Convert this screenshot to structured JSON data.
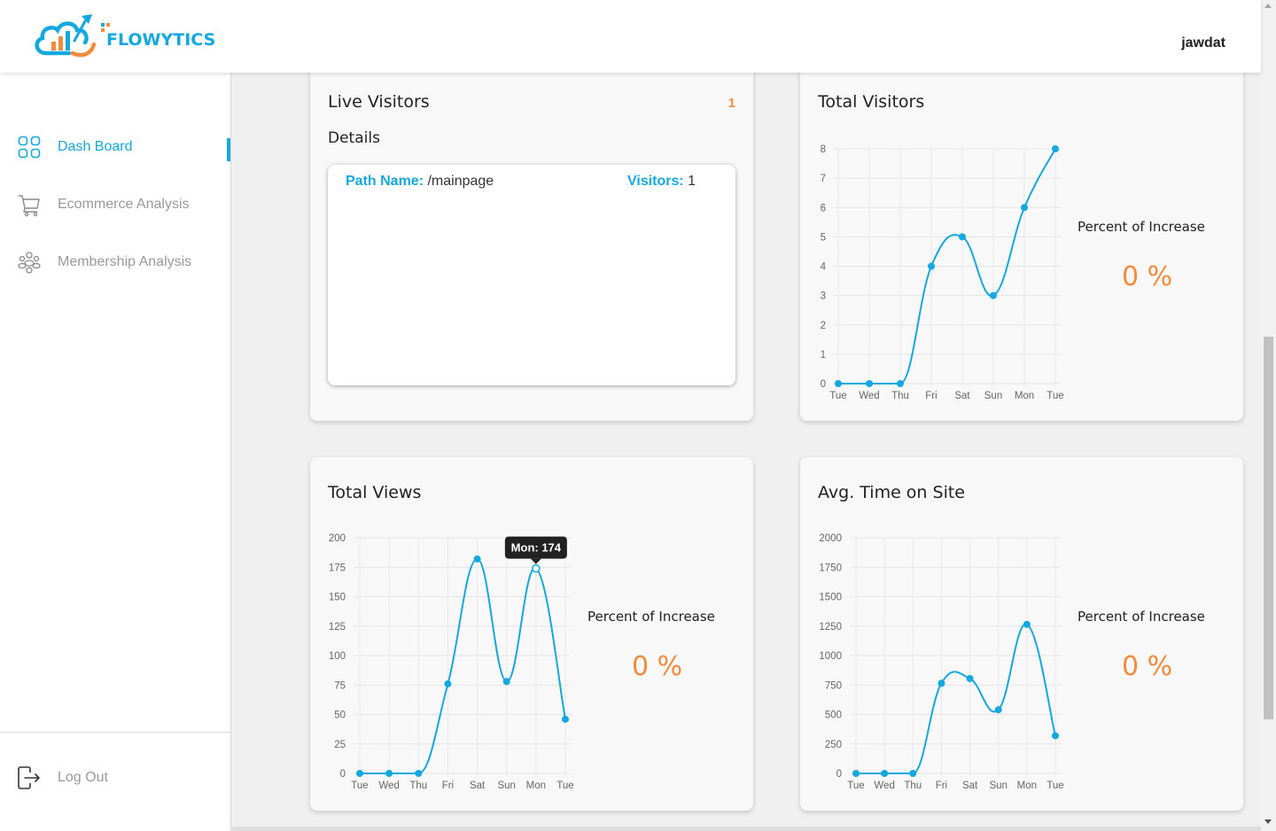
{
  "header": {
    "brand": "FLOWYTICS",
    "user": "jawdat"
  },
  "sidebar": {
    "items": [
      {
        "label": "Dash Board",
        "icon": "grid-icon",
        "active": true
      },
      {
        "label": "Ecommerce Analysis",
        "icon": "cart-icon",
        "active": false
      },
      {
        "label": "Membership Analysis",
        "icon": "users-icon",
        "active": false
      }
    ],
    "logout": {
      "label": "Log Out",
      "icon": "logout-icon"
    }
  },
  "live": {
    "title": "Live Visitors",
    "count": "1",
    "details_label": "Details",
    "path_label": "Path Name:",
    "path_value": " /mainpage",
    "visitors_label": "Visitors:",
    "visitors_value": " 1"
  },
  "percent_title": "Percent of Increase",
  "percent_value": "0 %",
  "colors": {
    "accent": "#14a8e0",
    "orange": "#f58a3a"
  },
  "chart_data": [
    {
      "id": "total-visitors",
      "title": "Total Visitors",
      "type": "line",
      "categories": [
        "Tue",
        "Wed",
        "Thu",
        "Fri",
        "Sat",
        "Sun",
        "Mon",
        "Tue"
      ],
      "values": [
        0,
        0,
        0,
        4,
        5,
        3,
        6,
        8
      ],
      "yticks": [
        0,
        1,
        2,
        3,
        4,
        5,
        6,
        7,
        8
      ],
      "ylim": [
        0,
        8
      ],
      "grid": true
    },
    {
      "id": "total-views",
      "title": "Total Views",
      "type": "line",
      "categories": [
        "Tue",
        "Wed",
        "Thu",
        "Fri",
        "Sat",
        "Sun",
        "Mon",
        "Tue"
      ],
      "values": [
        0,
        0,
        0,
        76,
        182,
        78,
        174,
        46
      ],
      "yticks": [
        0,
        25,
        50,
        75,
        100,
        125,
        150,
        175,
        200
      ],
      "ylim": [
        0,
        200
      ],
      "grid": true,
      "tooltip": {
        "label": "Mon: 174",
        "index": 6
      }
    },
    {
      "id": "avg-time",
      "title": "Avg. Time on Site",
      "type": "line",
      "categories": [
        "Tue",
        "Wed",
        "Thu",
        "Fri",
        "Sat",
        "Sun",
        "Mon",
        "Tue"
      ],
      "values": [
        0,
        0,
        0,
        765,
        805,
        540,
        1265,
        320
      ],
      "yticks": [
        0,
        250,
        500,
        750,
        1000,
        1250,
        1500,
        1750,
        2000
      ],
      "ylim": [
        0,
        2000
      ],
      "grid": true
    }
  ]
}
